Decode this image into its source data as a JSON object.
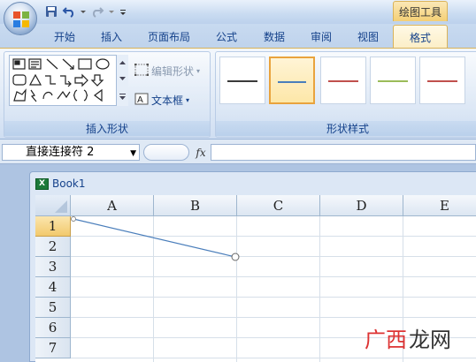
{
  "app": {
    "context_group": "绘图工具",
    "tabs": [
      {
        "label": "开始"
      },
      {
        "label": "插入"
      },
      {
        "label": "页面布局"
      },
      {
        "label": "公式"
      },
      {
        "label": "数据"
      },
      {
        "label": "审阅"
      },
      {
        "label": "视图"
      },
      {
        "label": "格式",
        "active": true
      }
    ]
  },
  "qat": {
    "icons": [
      "save-icon",
      "undo-icon",
      "redo-icon",
      "customize-icon"
    ]
  },
  "ribbon": {
    "insert_shapes": {
      "label": "插入形状",
      "edit_shape": "编辑形状",
      "text_box": "文本框"
    },
    "shape_styles": {
      "label": "形状样式",
      "swatch_colors": [
        "#3a3a3a",
        "#4a7ebb",
        "#c0504d",
        "#9bbb59",
        "#c0504d"
      ]
    }
  },
  "formula_bar": {
    "name_box": "直接连接符 2",
    "fx_label": "fx",
    "formula": ""
  },
  "workbook": {
    "title": "Book1",
    "columns": [
      "A",
      "B",
      "C",
      "D",
      "E"
    ],
    "rows": [
      "1",
      "2",
      "3",
      "4",
      "5",
      "6",
      "7"
    ]
  },
  "watermark": {
    "part1": "广西",
    "part2": "龙网"
  }
}
